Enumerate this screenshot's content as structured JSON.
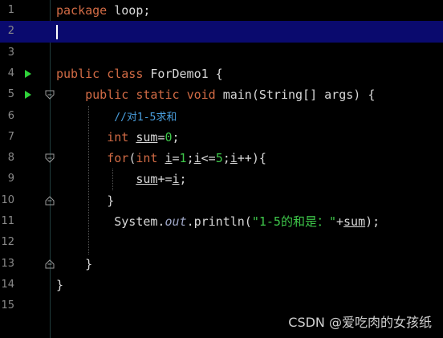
{
  "editor": {
    "lines": [
      {
        "n": "1",
        "tokens": [
          [
            "kw",
            "package"
          ],
          [
            "t",
            " loop;"
          ]
        ]
      },
      {
        "n": "2",
        "tokens": [],
        "current": true,
        "caret": true
      },
      {
        "n": "3",
        "tokens": []
      },
      {
        "n": "4",
        "run": true,
        "tokens": [
          [
            "kw",
            "public"
          ],
          [
            "t",
            " "
          ],
          [
            "kw",
            "class"
          ],
          [
            "t",
            " ForDemo1 {"
          ]
        ]
      },
      {
        "n": "5",
        "run": true,
        "fold": "minus",
        "tokens": [
          [
            "t",
            "    "
          ],
          [
            "kw",
            "public"
          ],
          [
            "t",
            " "
          ],
          [
            "kw",
            "static"
          ],
          [
            "t",
            " "
          ],
          [
            "kw",
            "void"
          ],
          [
            "t",
            " "
          ],
          [
            "fn",
            "main"
          ],
          [
            "t",
            "(String[] args) {"
          ]
        ]
      },
      {
        "n": "6",
        "tokens": [
          [
            "t",
            "        "
          ],
          [
            "cmt",
            "//对1-5求和"
          ]
        ]
      },
      {
        "n": "7",
        "tokens": [
          [
            "t",
            "       "
          ],
          [
            "kw",
            "int"
          ],
          [
            "t",
            " "
          ],
          [
            "u",
            "sum"
          ],
          [
            "t",
            "="
          ],
          [
            "num",
            "0"
          ],
          [
            "t",
            ";"
          ]
        ]
      },
      {
        "n": "8",
        "fold": "minus",
        "tokens": [
          [
            "t",
            "       "
          ],
          [
            "kw",
            "for"
          ],
          [
            "t",
            "("
          ],
          [
            "kw",
            "int"
          ],
          [
            "t",
            " "
          ],
          [
            "u",
            "i"
          ],
          [
            "t",
            "="
          ],
          [
            "num",
            "1"
          ],
          [
            "t",
            ";"
          ],
          [
            "u",
            "i"
          ],
          [
            "t",
            "<="
          ],
          [
            "num",
            "5"
          ],
          [
            "t",
            ";"
          ],
          [
            "u",
            "i"
          ],
          [
            "t",
            "++){"
          ]
        ]
      },
      {
        "n": "9",
        "tokens": [
          [
            "t",
            "           "
          ],
          [
            "u",
            "sum"
          ],
          [
            "t",
            "+="
          ],
          [
            "u",
            "i"
          ],
          [
            "t",
            ";"
          ]
        ]
      },
      {
        "n": "10",
        "fold": "end",
        "tokens": [
          [
            "t",
            "       }"
          ]
        ]
      },
      {
        "n": "11",
        "tokens": [
          [
            "t",
            "        System."
          ],
          [
            "ita",
            "out"
          ],
          [
            "t",
            ".println("
          ],
          [
            "str",
            "\"1-5的和是：\""
          ],
          [
            "t",
            "+"
          ],
          [
            "u",
            "sum"
          ],
          [
            "t",
            ");"
          ]
        ]
      },
      {
        "n": "12",
        "tokens": []
      },
      {
        "n": "13",
        "fold": "end",
        "tokens": [
          [
            "t",
            "    }"
          ]
        ]
      },
      {
        "n": "14",
        "tokens": [
          [
            "t",
            "}"
          ]
        ]
      },
      {
        "n": "15",
        "tokens": []
      }
    ]
  },
  "watermark": "CSDN @爱吃肉的女孩纸",
  "colors": {
    "background": "#000000",
    "current_line": "#0a0a6e",
    "keyword": "#d26b45",
    "literal": "#3ec84a",
    "comment": "#4aa0e0",
    "run_marker": "#2fd33a"
  }
}
